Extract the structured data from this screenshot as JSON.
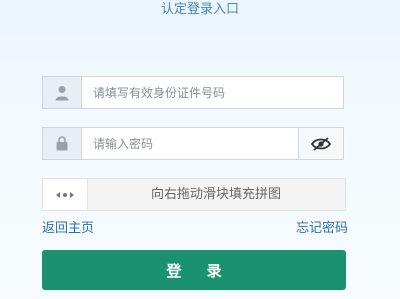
{
  "title": "认定登录入口",
  "username": {
    "placeholder": "请填写有效身份证件号码",
    "icon": "user-icon"
  },
  "password": {
    "placeholder": "请输入密码",
    "icon": "lock-icon",
    "toggle_icon": "eye-slash-icon"
  },
  "slider": {
    "hint": "向右拖动滑块填充拼图",
    "icon": "drag-arrows-icon"
  },
  "links": {
    "home": "返回主页",
    "forgot": "忘记密码"
  },
  "login_button": "登 录",
  "colors": {
    "accent": "#1a9270",
    "link": "#2f6db0",
    "title": "#4a86b8"
  }
}
